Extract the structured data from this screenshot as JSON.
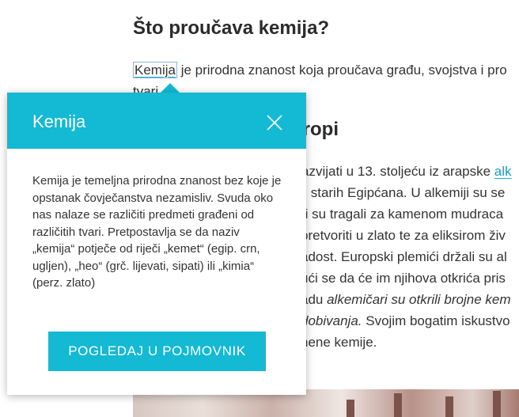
{
  "article": {
    "heading1": "Što proučava kemija?",
    "para1": {
      "term": "Kemija",
      "line1_rest": " je prirodna znanost koja proučava građu, svojstva i pro",
      "line2": "tvari."
    },
    "heading2_visible": "uropi",
    "para2": {
      "l1_a": "azvijati u 13. stoljeću iz arapske ",
      "l1_link": "alk",
      "l2_a": "",
      "l2_b": " starih Egipćana. U alkemiji su se",
      "l3": "ri su tragali za kamenom mudraca",
      "l4": "pretvoriti u zlato te za eliksirom živ",
      "l5": "adost. Europski plemići držali su al",
      "l6": "ući se da će im njihova otkrića pris",
      "l7_a": "adu ",
      "l7_italic": "alkemičari su otkrili brojne kem",
      "l8_italic": "dobivanja.",
      "l8_b": " Svojim bogatim iskustvo",
      "l9": "nene kemije."
    }
  },
  "popup": {
    "title": "Kemija",
    "body": "Kemija je temeljna prirodna znanost bez koje je opstanak čovječanstva nezamisliv. Svuda oko nas nalaze se različiti predmeti građeni od različitih tvari. Pretpostavlja se da naziv „kemija“ potječe od riječi „kemet“ (egip. crn, ugljen), „heo“ (grč. lijevati, sipati) ili „kimia“ (perz. zlato)",
    "button_label": "POGLEDAJ U POJMOVNIK",
    "close_icon": "close-icon"
  },
  "colors": {
    "accent": "#14b9d3",
    "text": "#333333",
    "heading": "#2b2b2b"
  }
}
